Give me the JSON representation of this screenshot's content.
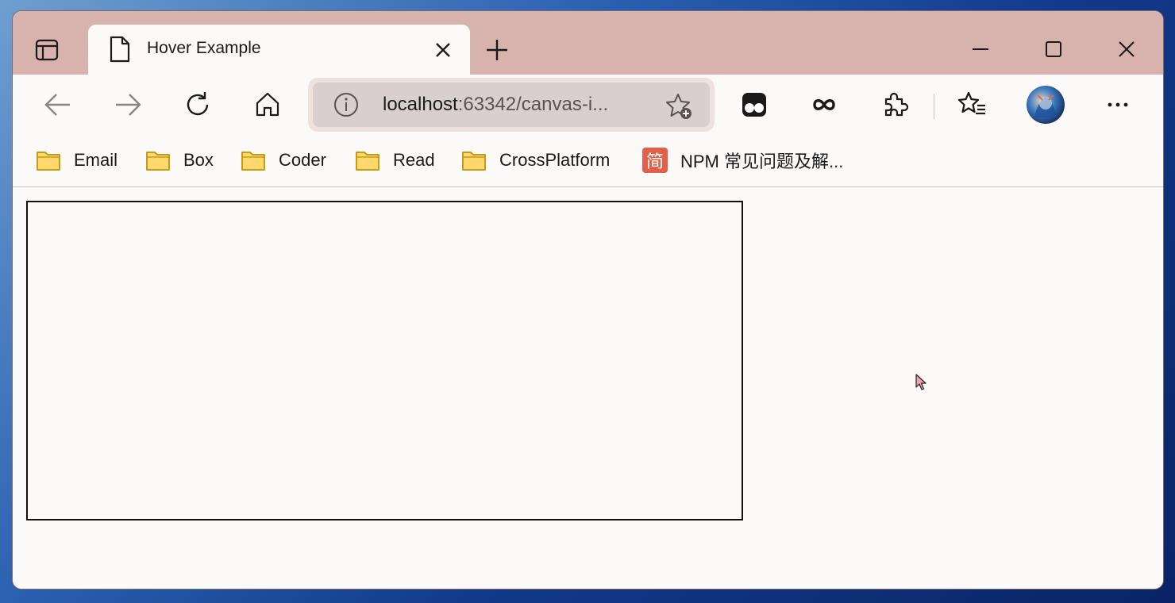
{
  "tab": {
    "title": "Hover Example"
  },
  "address": {
    "host": "localhost",
    "rest": ":63342/canvas-i..."
  },
  "bookmarks": [
    {
      "label": "Email",
      "icon": "folder-icon"
    },
    {
      "label": "Box",
      "icon": "folder-icon"
    },
    {
      "label": "Coder",
      "icon": "folder-icon"
    },
    {
      "label": "Read",
      "icon": "folder-icon"
    },
    {
      "label": "CrossPlatform",
      "icon": "folder-icon"
    },
    {
      "label": "NPM 常见问题及解...",
      "icon": "jian-site-icon",
      "badge": "简"
    }
  ],
  "colors": {
    "titlebar": "#d8b2ac",
    "page_bg": "#fbfaf9",
    "folder_fill": "#ffd86e",
    "folder_stroke": "#c79a16",
    "jian_badge": "#e0604a"
  }
}
